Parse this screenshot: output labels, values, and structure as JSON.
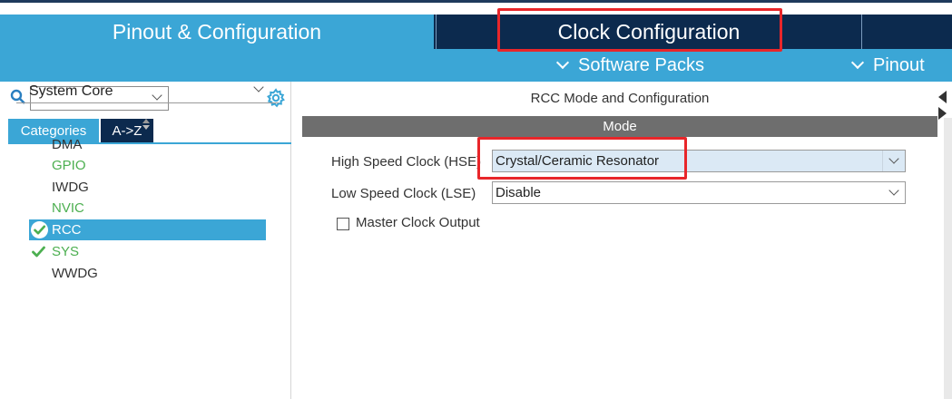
{
  "window": {
    "accent_color": "#3ba6d6",
    "dark_color": "#0c2a4e",
    "highlight_color": "#e8262a"
  },
  "tabs": {
    "pinout_config": "Pinout & Configuration",
    "clock_config": "Clock Configuration"
  },
  "subbar": {
    "software_packs": "Software Packs",
    "pinout": "Pinout"
  },
  "left": {
    "search": {
      "value": ""
    },
    "categories_tab": "Categories",
    "az_tab": "A->Z",
    "section": "System Core",
    "items": [
      {
        "label": "DMA",
        "state": "normal"
      },
      {
        "label": "GPIO",
        "state": "green"
      },
      {
        "label": "IWDG",
        "state": "normal"
      },
      {
        "label": "NVIC",
        "state": "green"
      },
      {
        "label": "RCC",
        "state": "selected"
      },
      {
        "label": "SYS",
        "state": "checked"
      },
      {
        "label": "WWDG",
        "state": "normal"
      }
    ]
  },
  "right": {
    "title": "RCC Mode and Configuration",
    "mode_header": "Mode",
    "hse_label": "High Speed Clock (HSE)",
    "hse_value": "Crystal/Ceramic Resonator",
    "lse_label": "Low Speed Clock (LSE)",
    "lse_value": "Disable",
    "mco_label": "Master Clock Output"
  }
}
